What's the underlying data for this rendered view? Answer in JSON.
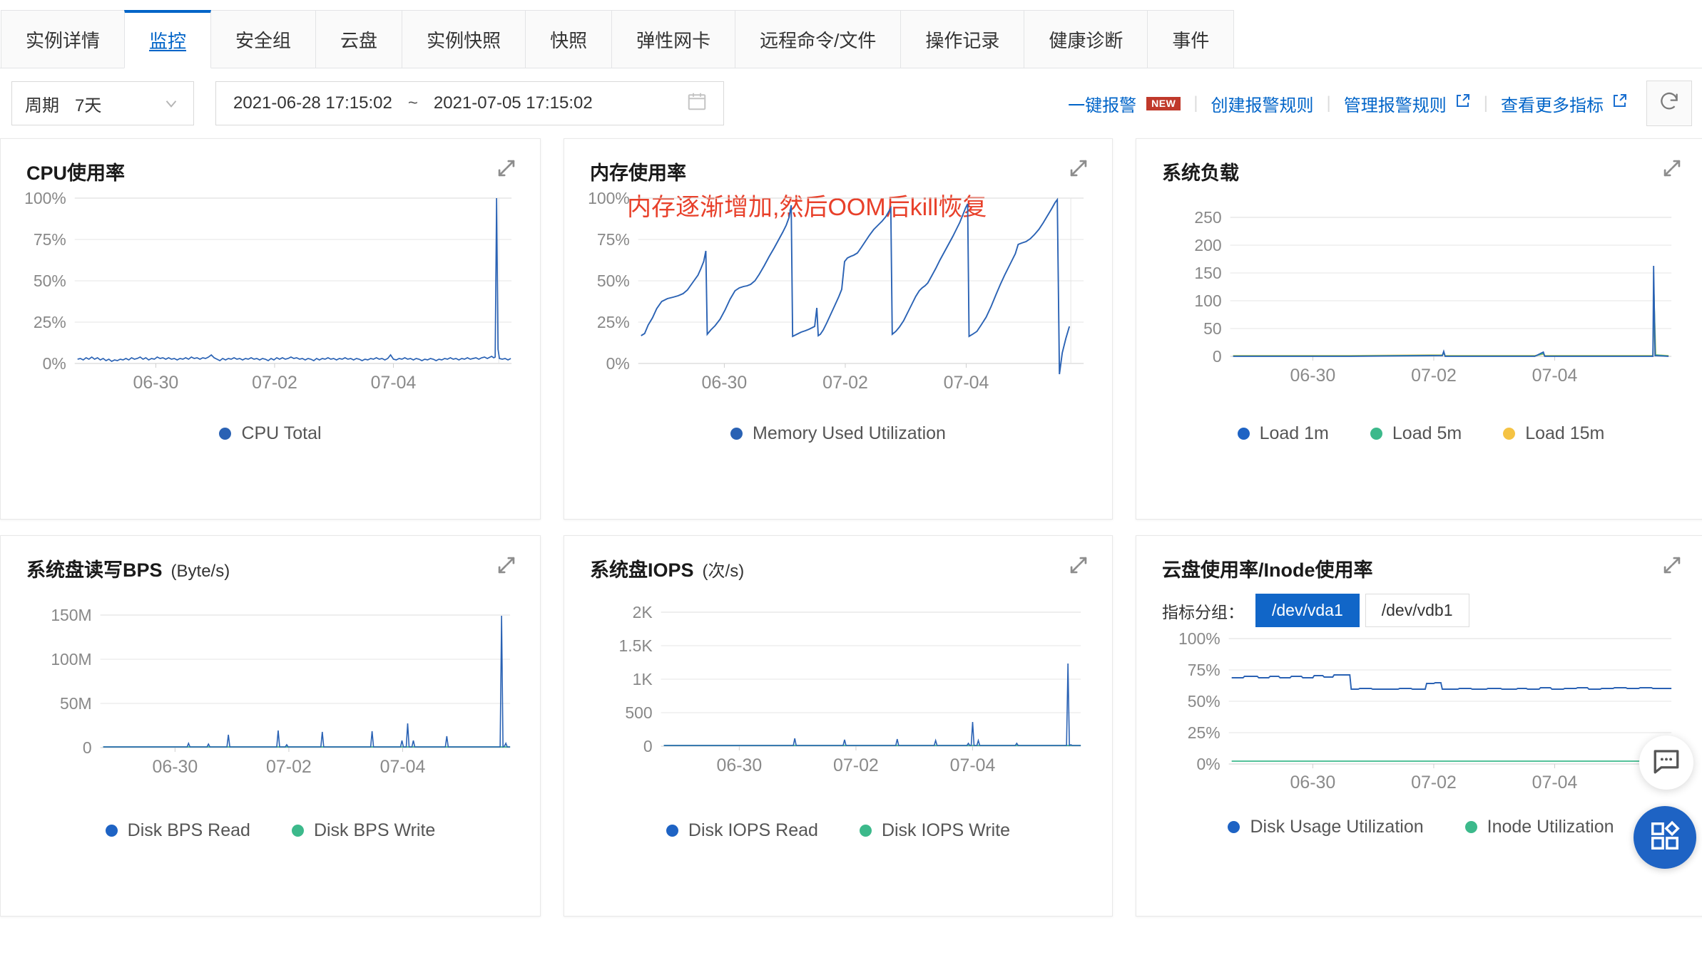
{
  "tabs": [
    {
      "label": "实例详情",
      "active": false
    },
    {
      "label": "监控",
      "active": true
    },
    {
      "label": "安全组",
      "active": false
    },
    {
      "label": "云盘",
      "active": false
    },
    {
      "label": "实例快照",
      "active": false
    },
    {
      "label": "快照",
      "active": false
    },
    {
      "label": "弹性网卡",
      "active": false
    },
    {
      "label": "远程命令/文件",
      "active": false
    },
    {
      "label": "操作记录",
      "active": false
    },
    {
      "label": "健康诊断",
      "active": false
    },
    {
      "label": "事件",
      "active": false
    }
  ],
  "toolbar": {
    "period_label": "周期",
    "period_value": "7天",
    "range_start": "2021-06-28 17:15:02",
    "range_tilde": "~",
    "range_end": "2021-07-05 17:15:02",
    "one_click_alarm": "一键报警",
    "new_badge": "NEW",
    "create_alarm_rule": "创建报警规则",
    "manage_alarm_rule": "管理报警规则",
    "view_more_metrics": "查看更多指标",
    "separator": "|",
    "refresh_icon": "refresh-icon",
    "calendar_icon": "calendar-icon",
    "chevron_down_icon": "chevron-down-icon",
    "external-link_icon": "external-link-icon"
  },
  "colors": {
    "accent": "#0064c8",
    "series_blue": "#2a62b4",
    "series_green": "#3cb98b",
    "series_yellow": "#f5c343",
    "annotation_red": "#e8402a",
    "active_group": "#1166c8"
  },
  "cards": [
    {
      "title": "CPU使用率",
      "unit": "",
      "expand_icon": "expand-icon",
      "legend": [
        {
          "label": "CPU Total",
          "color": "#2a62b4"
        }
      ]
    },
    {
      "title": "内存使用率",
      "unit": "",
      "annotation": "内存逐渐增加,然后OOM后kill恢复",
      "expand_icon": "expand-icon",
      "legend": [
        {
          "label": "Memory Used Utilization",
          "color": "#2a62b4"
        }
      ]
    },
    {
      "title": "系统负载",
      "unit": "",
      "expand_icon": "expand-icon",
      "legend": [
        {
          "label": "Load 1m",
          "color": "#1e63c4"
        },
        {
          "label": "Load 5m",
          "color": "#3cb98b"
        },
        {
          "label": "Load 15m",
          "color": "#f5c343"
        }
      ]
    },
    {
      "title": "系统盘读写BPS",
      "unit": "(Byte/s)",
      "expand_icon": "expand-icon",
      "legend": [
        {
          "label": "Disk BPS Read",
          "color": "#1e63c4"
        },
        {
          "label": "Disk BPS Write",
          "color": "#3cb98b"
        }
      ]
    },
    {
      "title": "系统盘IOPS",
      "unit": "(次/s)",
      "expand_icon": "expand-icon",
      "legend": [
        {
          "label": "Disk IOPS Read",
          "color": "#1e63c4"
        },
        {
          "label": "Disk IOPS Write",
          "color": "#3cb98b"
        }
      ]
    },
    {
      "title": "云盘使用率/Inode使用率",
      "unit": "",
      "expand_icon": "expand-icon",
      "group_label": "指标分组：",
      "groups": [
        {
          "label": "/dev/vda1",
          "active": true
        },
        {
          "label": "/dev/vdb1",
          "active": false
        }
      ],
      "legend": [
        {
          "label": "Disk Usage Utilization",
          "color": "#1e63c4"
        },
        {
          "label": "Inode Utilization",
          "color": "#3cb98b"
        }
      ]
    }
  ],
  "chart_data": [
    {
      "type": "line",
      "title": "CPU使用率",
      "ylabel": "",
      "xlabel": "",
      "yticks": [
        "0%",
        "25%",
        "50%",
        "75%",
        "100%"
      ],
      "ylim": [
        0,
        100
      ],
      "xticks": [
        "06-30",
        "07-02",
        "07-04"
      ],
      "grid": true,
      "legend_position": "bottom",
      "series": [
        {
          "name": "CPU Total",
          "color": "#2a62b4",
          "description": "Near-zero baseline around 2-4% across the whole week with small ripples; single vertical spike to 100% at far right (~07-05), plus a tiny bump ~6% near 07-04.",
          "values": [
            3,
            2,
            3,
            2,
            2,
            3,
            3,
            2,
            2,
            2,
            3,
            3,
            4,
            3,
            2,
            2,
            3,
            3,
            3,
            3,
            3,
            4,
            3,
            3,
            2,
            2,
            3,
            3,
            4,
            4,
            3,
            3,
            3,
            2,
            3,
            3,
            4,
            4,
            3,
            3,
            3,
            3,
            4,
            3,
            3,
            3,
            2,
            2,
            3,
            3,
            3,
            4,
            3,
            3,
            3,
            4,
            5,
            4,
            3,
            3,
            3,
            3,
            4,
            3,
            3,
            3,
            3,
            3,
            3,
            4,
            4,
            3,
            3,
            3,
            2,
            2,
            3,
            3,
            3,
            3,
            3,
            3,
            4,
            6,
            3,
            3,
            3,
            3,
            3,
            3,
            3,
            3,
            4,
            3,
            3,
            3,
            3,
            3,
            3,
            4,
            4,
            100,
            8,
            3,
            3
          ]
        }
      ]
    },
    {
      "type": "line",
      "title": "内存使用率",
      "annotation": "内存逐渐增加,然后OOM后kill恢复",
      "yticks": [
        "0%",
        "25%",
        "50%",
        "75%",
        "100%"
      ],
      "ylim": [
        0,
        100
      ],
      "xticks": [
        "06-30",
        "07-02",
        "07-04"
      ],
      "grid": true,
      "legend_position": "bottom",
      "series": [
        {
          "name": "Memory Used Utilization",
          "color": "#2a62b4",
          "description": "Sawtooth: memory grows gradually then drops sharply after OOM kill. Five rise-and-reset cycles, peaks ~68%, ~96%, ~94%, ~97%, ~99%.",
          "values": [
            17,
            19,
            26,
            34,
            40,
            42,
            43,
            45,
            50,
            57,
            63,
            68,
            19,
            22,
            30,
            42,
            48,
            49,
            50,
            52,
            58,
            66,
            74,
            82,
            90,
            96,
            18,
            19,
            20,
            21,
            22,
            24,
            37,
            19,
            21,
            24,
            29,
            37,
            46,
            55,
            63,
            64,
            66,
            68,
            70,
            75,
            82,
            88,
            92,
            94,
            19,
            20,
            23,
            28,
            34,
            42,
            46,
            47,
            49,
            55,
            62,
            68,
            74,
            80,
            85,
            88,
            93,
            96,
            97,
            17,
            18,
            20,
            24,
            30,
            40,
            52,
            60,
            66,
            72,
            78,
            79,
            80,
            82,
            84,
            88,
            93,
            99,
            13,
            20,
            25
          ]
        }
      ]
    },
    {
      "type": "line",
      "title": "系统负载",
      "yticks": [
        "0",
        "50",
        "100",
        "150",
        "200",
        "250"
      ],
      "ylim": [
        0,
        250
      ],
      "xticks": [
        "06-30",
        "07-02",
        "07-04"
      ],
      "grid": true,
      "legend_position": "bottom",
      "series": [
        {
          "name": "Load 1m",
          "color": "#1e63c4",
          "description": "Flat ~0 with tiny bumps; single spike to ~163 at far right.",
          "peak": 163
        },
        {
          "name": "Load 5m",
          "color": "#3cb98b",
          "description": "Flat ~0; spike to ~112 at far right.",
          "peak": 112
        },
        {
          "name": "Load 15m",
          "color": "#f5c343",
          "description": "Flat ~0; spike to ~82 at far right.",
          "peak": 82
        }
      ]
    },
    {
      "type": "line",
      "title": "系统盘读写BPS",
      "unit": "(Byte/s)",
      "yticks": [
        "0",
        "50M",
        "100M",
        "150M"
      ],
      "ylim": [
        0,
        165000000
      ],
      "xticks": [
        "06-30",
        "07-02",
        "07-04"
      ],
      "grid": true,
      "legend_position": "bottom",
      "series": [
        {
          "name": "Disk BPS Read",
          "color": "#1e63c4",
          "description": "Baseline ~0 with occasional spikes of 5M-20M; giant spike to ~153M at far right.",
          "peak": 153000000
        },
        {
          "name": "Disk BPS Write",
          "color": "#3cb98b",
          "description": "Flat near 0 throughout.",
          "peak": 2000000
        }
      ]
    },
    {
      "type": "line",
      "title": "系统盘IOPS",
      "unit": "(次/s)",
      "yticks": [
        "0",
        "500",
        "1K",
        "1.5K",
        "2K"
      ],
      "ylim": [
        0,
        2100
      ],
      "xticks": [
        "06-30",
        "07-02",
        "07-04"
      ],
      "grid": true,
      "legend_position": "bottom",
      "series": [
        {
          "name": "Disk IOPS Read",
          "color": "#1e63c4",
          "description": "Baseline ~0 with spikes around 80-120, one ~370 near 07-04; tall spike to ~1230 at far right.",
          "peak": 1230
        },
        {
          "name": "Disk IOPS Write",
          "color": "#3cb98b",
          "description": "Flat near 0 throughout.",
          "peak": 30
        }
      ]
    },
    {
      "type": "line",
      "title": "云盘使用率/Inode使用率",
      "yticks": [
        "0%",
        "25%",
        "50%",
        "75%",
        "100%"
      ],
      "ylim": [
        0,
        100
      ],
      "xticks": [
        "06-30",
        "07-02",
        "07-04"
      ],
      "grid": true,
      "legend_position": "bottom",
      "series": [
        {
          "name": "Disk Usage Utilization",
          "color": "#1e63c4",
          "description": "Step function: ~69-71% until mid 06-30, drops to ~60%, brief bump to ~65% near 07-02, then stays ~60-62%.",
          "values": [
            69,
            69,
            70,
            69,
            70,
            70,
            69,
            70,
            70,
            70,
            70,
            71,
            71,
            71,
            71,
            60,
            60,
            60,
            60,
            60,
            60,
            60,
            60,
            65,
            65,
            60,
            60,
            61,
            61,
            60,
            60,
            61,
            61,
            61,
            60,
            61,
            61,
            61,
            61,
            61,
            61,
            62,
            61,
            61,
            61,
            61,
            61
          ]
        },
        {
          "name": "Inode Utilization",
          "color": "#3cb98b",
          "description": "Flat ~2% for the whole range.",
          "values": [
            2,
            2,
            2,
            2,
            2,
            2,
            2,
            2,
            2,
            2,
            2,
            2,
            2,
            2,
            2,
            2,
            2,
            2,
            2,
            2,
            2,
            2,
            2,
            2,
            2,
            2,
            2,
            2,
            2,
            2,
            2,
            2,
            2,
            2,
            2,
            2,
            2,
            2,
            2,
            2,
            2,
            2,
            2,
            2,
            2,
            2,
            2
          ]
        }
      ]
    }
  ],
  "floating": {
    "chat_icon": "chat-bubble-icon",
    "apps_icon": "apps-grid-icon"
  }
}
